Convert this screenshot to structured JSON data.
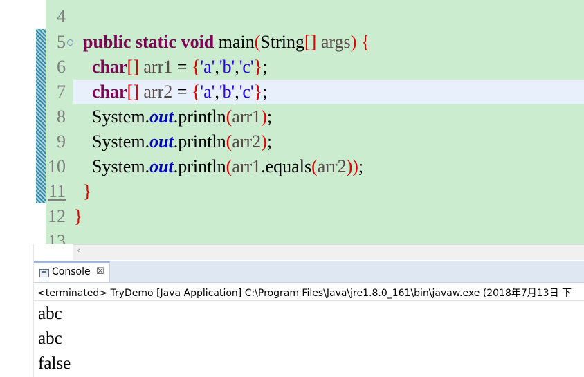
{
  "editor": {
    "lines": [
      {
        "num": "4",
        "code": ""
      },
      {
        "num": "5",
        "parts": {
          "kw": "public static void",
          "name": " main",
          "p1": "(",
          "type": "String",
          "arr": "[]",
          "args": " args",
          "p2": ")",
          "brace": " {"
        }
      },
      {
        "num": "6",
        "parts": {
          "kw": "char",
          "arr": "[]",
          "var": " arr1",
          "eq": " = ",
          "b1": "{",
          "s1": "'a'",
          "c1": ",",
          "s2": "'b'",
          "c2": ",",
          "s3": "'c'",
          "b2": "}",
          "semi": ";"
        }
      },
      {
        "num": "7",
        "parts": {
          "kw": "char",
          "arr": "[]",
          "var": " arr2",
          "eq": " = ",
          "b1": "{",
          "s1": "'a'",
          "c1": ",",
          "s2": "'b'",
          "c2": ",",
          "s3": "'c'",
          "b2": "}",
          "semi": ";"
        }
      },
      {
        "num": "8",
        "parts": {
          "sys": "System.",
          "out": "out",
          "m": ".println",
          "p1": "(",
          "arg": "arr1",
          "p2": ")",
          "semi": ";"
        }
      },
      {
        "num": "9",
        "parts": {
          "sys": "System.",
          "out": "out",
          "m": ".println",
          "p1": "(",
          "arg": "arr2",
          "p2": ")",
          "semi": ";"
        }
      },
      {
        "num": "10",
        "parts": {
          "sys": "System.",
          "out": "out",
          "m": ".println",
          "p1": "(",
          "arg": "arr1",
          "m2": ".equals",
          "p3": "(",
          "arg2": "arr2",
          "p4": "))",
          "semi": ";"
        }
      },
      {
        "num": "11",
        "parts": {
          "brace": "}"
        }
      },
      {
        "num": "12",
        "parts": {
          "brace": "}"
        }
      },
      {
        "num": "13",
        "code": ""
      }
    ]
  },
  "console": {
    "tab_label": "Console",
    "close_glyph": "☒",
    "status": "<terminated> TryDemo [Java Application] C:\\Program Files\\Java\\jre1.8.0_161\\bin\\javaw.exe (2018年7月13日 下",
    "output": [
      "abc",
      "abc",
      "false"
    ]
  },
  "icons": {
    "scroll_left": "‹"
  },
  "colors": {
    "editor_bg": "#cbeccf",
    "keyword": "#7f0055",
    "string": "#2a00ff",
    "bracket": "#e00000",
    "field": "#0000c0",
    "current_line": "#e8f0fb"
  }
}
